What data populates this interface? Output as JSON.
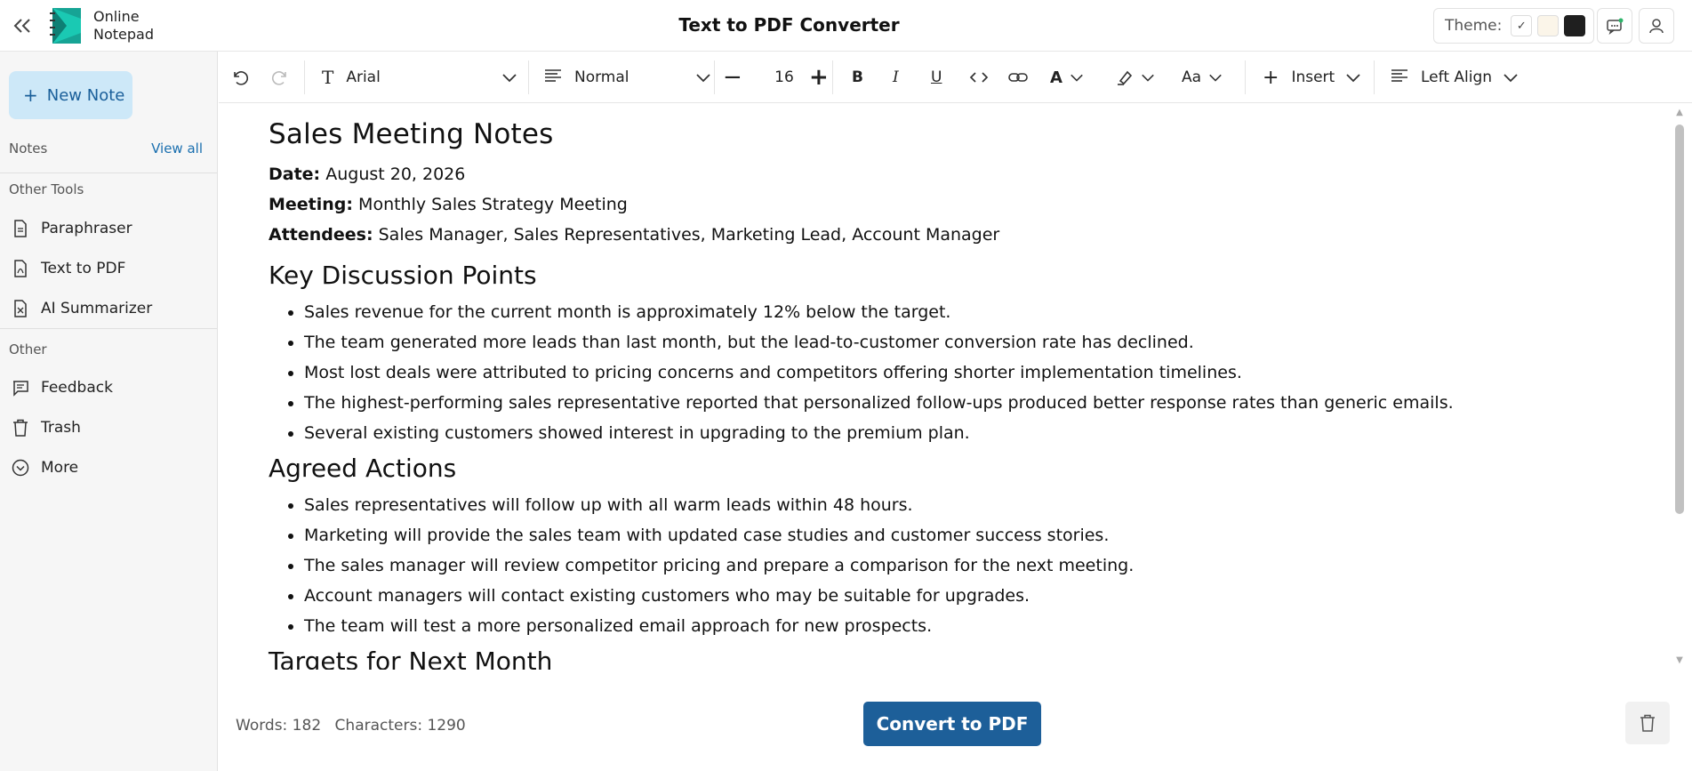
{
  "header": {
    "logo_text_line1": "Online",
    "logo_text_line2": "Notepad",
    "title": "Text to PDF Converter",
    "theme_label": "Theme:",
    "theme_swatches": [
      "#ffffff",
      "#fbf5e9",
      "#1f1f1f"
    ],
    "theme_selected_mark": "✓"
  },
  "sidebar": {
    "new_note_label": "New Note",
    "notes_label": "Notes",
    "view_all_label": "View all",
    "other_tools_label": "Other Tools",
    "tools": [
      {
        "label": "Paraphraser",
        "icon": "document-icon"
      },
      {
        "label": "Text to PDF",
        "icon": "pdf-file-icon"
      },
      {
        "label": "AI Summarizer",
        "icon": "summarizer-file-icon"
      }
    ],
    "other_label": "Other",
    "other_items": [
      {
        "label": "Feedback",
        "icon": "feedback-icon"
      },
      {
        "label": "Trash",
        "icon": "trash-icon"
      },
      {
        "label": "More",
        "icon": "chevron-circle-icon"
      }
    ]
  },
  "toolbar": {
    "font_family": "Arial",
    "paragraph_style": "Normal",
    "font_size": "16",
    "case_label": "Aa",
    "insert_label": "Insert",
    "align_label": "Left Align"
  },
  "document": {
    "title": "Sales Meeting Notes",
    "date_label": "Date:",
    "date_value": "August 20, 2026",
    "meeting_label": "Meeting:",
    "meeting_value": "Monthly Sales Strategy Meeting",
    "attendees_label": "Attendees:",
    "attendees_value": "Sales Manager, Sales Representatives, Marketing Lead, Account Manager",
    "section1_heading": "Key Discussion Points",
    "section1_items": [
      "Sales revenue for the current month is approximately 12% below the target.",
      "The team generated more leads than last month, but the lead-to-customer conversion rate has declined.",
      "Most lost deals were attributed to pricing concerns and competitors offering shorter implementation timelines.",
      "The highest-performing sales representative reported that personalized follow-ups produced better response rates than generic emails.",
      "Several existing customers showed interest in upgrading to the premium plan."
    ],
    "section2_heading": "Agreed Actions",
    "section2_items": [
      "Sales representatives will follow up with all warm leads within 48 hours.",
      "Marketing will provide the sales team with updated case studies and customer success stories.",
      "The sales manager will review competitor pricing and prepare a comparison for the next meeting.",
      "Account managers will contact existing customers who may be suitable for upgrades.",
      "The team will test a more personalized email approach for new prospects."
    ],
    "section3_heading": "Targets for Next Month"
  },
  "footer": {
    "words_label": "Words: 182",
    "characters_label": "Characters: 1290",
    "convert_label": "Convert to PDF"
  },
  "colors": {
    "accent": "#1d5f99",
    "new_note_bg": "#cde8f8",
    "logo_teal": "#18b6a6"
  }
}
